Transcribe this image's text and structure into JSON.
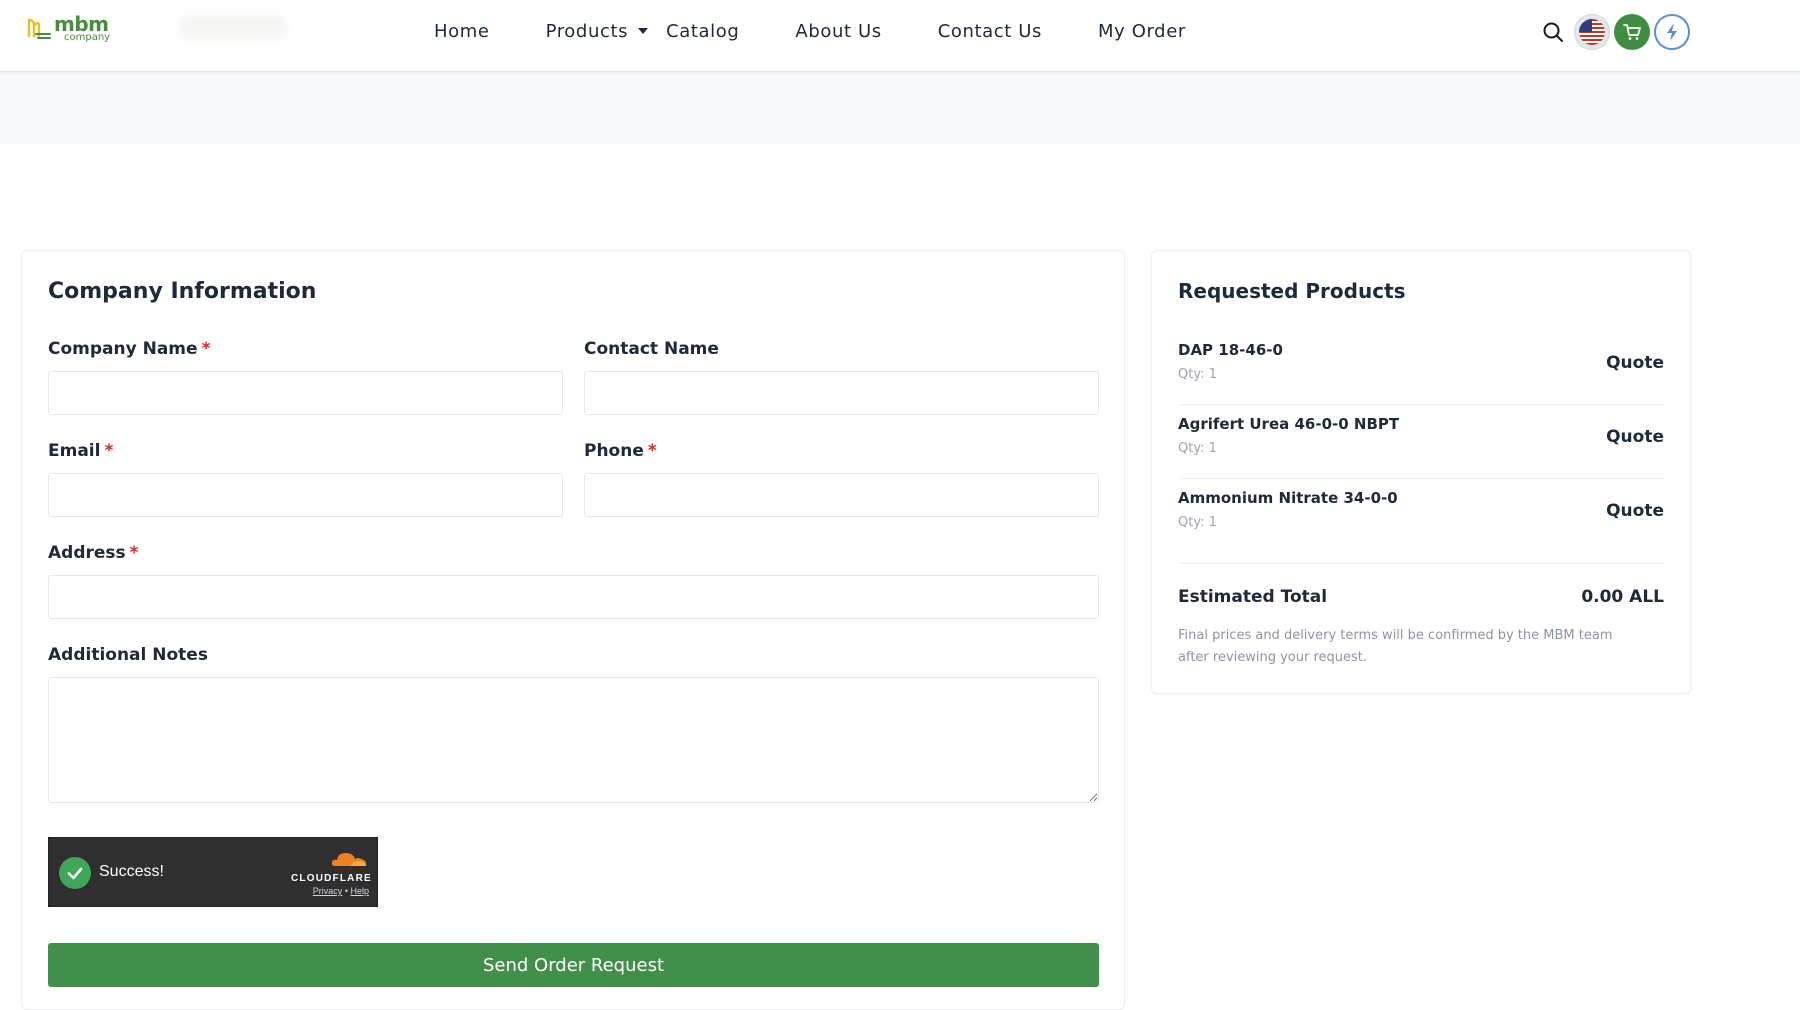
{
  "brand": {
    "logo_text": "mbm",
    "logo_sub": "company",
    "accent": "#428f4b"
  },
  "nav": {
    "home": "Home",
    "products": "Products",
    "catalog": "Catalog",
    "about": "About Us",
    "contact": "Contact Us",
    "my_order": "My Order"
  },
  "header_icons": [
    "search-icon",
    "us-flag-icon",
    "cart-icon",
    "user-profile-icon"
  ],
  "form": {
    "title": "Company Information",
    "company_name_label": "Company Name",
    "contact_name_label": "Contact Name",
    "email_label": "Email",
    "phone_label": "Phone",
    "address_label": "Address",
    "notes_label": "Additional Notes",
    "required_mark": "*",
    "company_name_value": "",
    "contact_name_value": "",
    "email_value": "",
    "phone_value": "",
    "address_value": "",
    "notes_value": "",
    "captcha": {
      "status": "Success!",
      "provider": "CLOUDFLARE",
      "privacy": "Privacy",
      "separator": "•",
      "help": "Help"
    },
    "submit_label": "Send Order Request"
  },
  "summary": {
    "title": "Requested Products",
    "products": [
      {
        "name": "DAP 18-46-0",
        "qty": "Qty: 1",
        "price": "Quote"
      },
      {
        "name": "Agrifert Urea 46-0-0 NBPT",
        "qty": "Qty: 1",
        "price": "Quote"
      },
      {
        "name": "Ammonium Nitrate 34-0-0",
        "qty": "Qty: 1",
        "price": "Quote"
      }
    ],
    "total_label": "Estimated Total",
    "total_value": "0.00 ALL",
    "disclaimer": "Final prices and delivery terms will be confirmed by the MBM team after reviewing your request."
  }
}
